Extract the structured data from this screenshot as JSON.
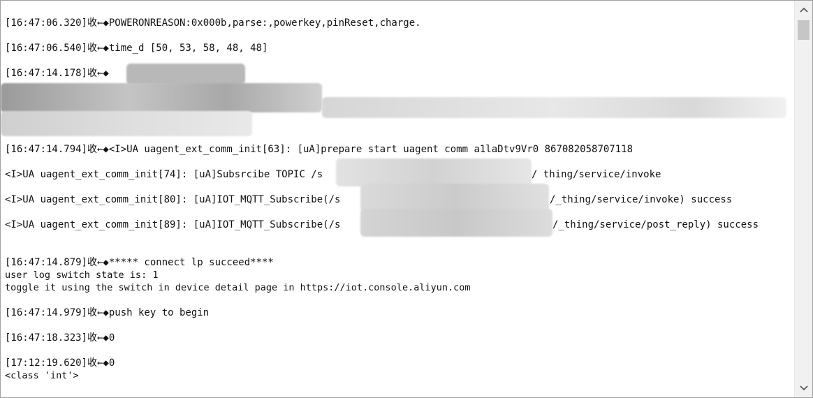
{
  "log": {
    "lines": [
      "[16:47:06.320]收←◆POWERONREASON:0x000b,parse:,powerkey,pinReset,charge.",
      "[16:47:06.540]收←◆time_d [50, 53, 58, 48, 48]",
      "[16:47:14.178]收←◆",
      "[16:47:14.794]收←◆<I>UA uagent_ext_comm_init[63]: [uA]prepare start uagent comm a1laDtv9Vr0 867082058707118",
      "<I>UA uagent_ext_comm_init[74]: [uA]Subsrcibe TOPIC /s",
      "/ thing/service/invoke",
      "<I>UA uagent_ext_comm_init[80]: [uA]IOT_MQTT_Subscribe(/s",
      "/_thing/service/invoke) success",
      "<I>UA uagent_ext_comm_init[89]: [uA]IOT_MQTT_Subscribe(/s",
      "/_thing/service/post_reply) success",
      "[16:47:14.879]收←◆***** connect lp succeed****",
      "user log switch state is: 1",
      "toggle it using the switch in device detail page in https://iot.console.aliyun.com",
      "[16:47:14.979]收←◆push key to begin",
      "[16:47:18.323]收←◆0",
      "[17:12:19.620]收←◆0",
      "<class 'int'>"
    ]
  },
  "scrollbar": {
    "up_arrow": "^",
    "down_arrow": "v"
  }
}
